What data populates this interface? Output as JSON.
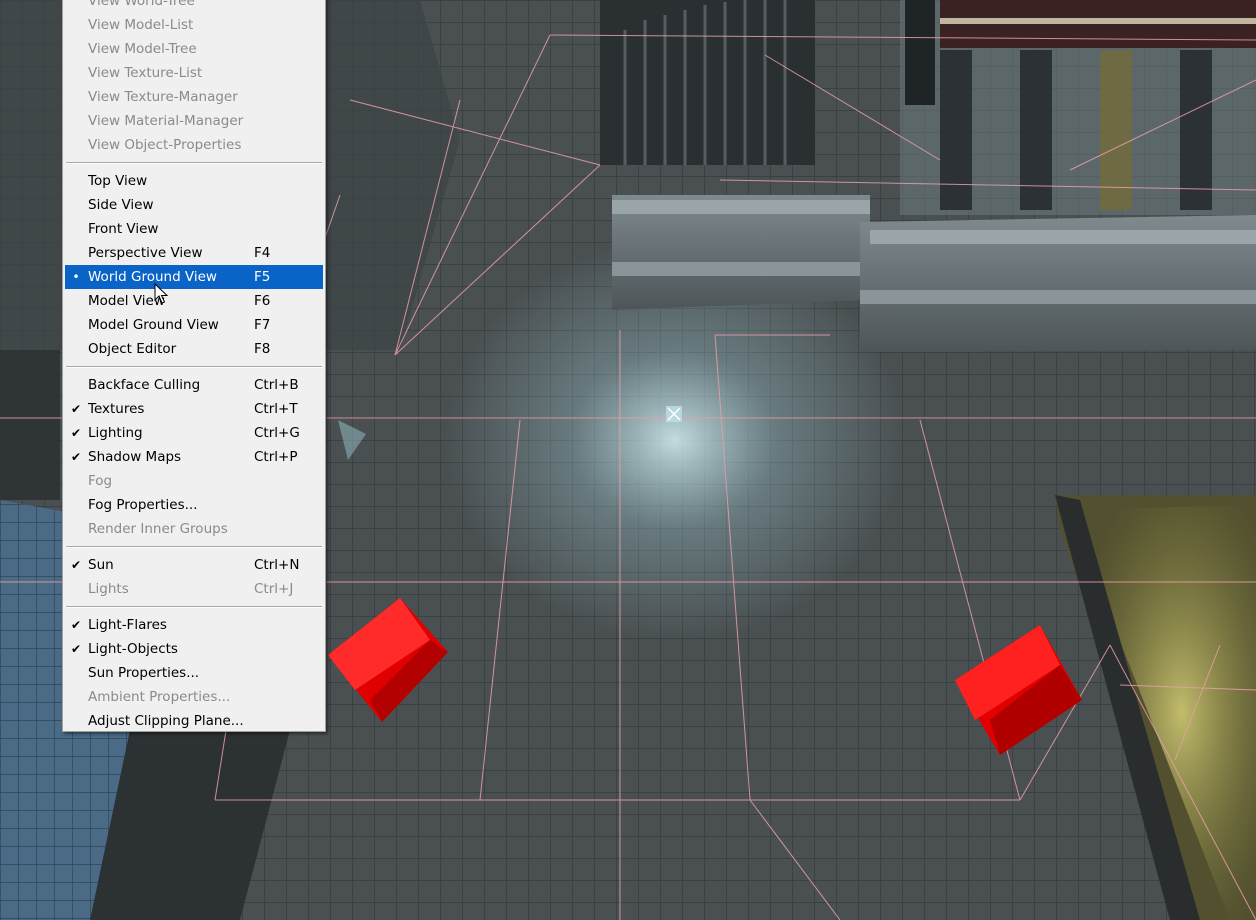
{
  "menu": {
    "items": [
      {
        "label": "View World-Tree",
        "shortcut": "",
        "disabled": true,
        "check": ""
      },
      {
        "label": "View Model-List",
        "shortcut": "",
        "disabled": true,
        "check": ""
      },
      {
        "label": "View Model-Tree",
        "shortcut": "",
        "disabled": true,
        "check": ""
      },
      {
        "label": "View Texture-List",
        "shortcut": "",
        "disabled": true,
        "check": ""
      },
      {
        "label": "View Texture-Manager",
        "shortcut": "",
        "disabled": true,
        "check": ""
      },
      {
        "label": "View Material-Manager",
        "shortcut": "",
        "disabled": true,
        "check": ""
      },
      {
        "label": "View Object-Properties",
        "shortcut": "",
        "disabled": true,
        "check": ""
      },
      {
        "label": "Top View",
        "shortcut": "",
        "disabled": false,
        "check": ""
      },
      {
        "label": "Side View",
        "shortcut": "",
        "disabled": false,
        "check": ""
      },
      {
        "label": "Front View",
        "shortcut": "",
        "disabled": false,
        "check": ""
      },
      {
        "label": "Perspective View",
        "shortcut": "F4",
        "disabled": false,
        "check": ""
      },
      {
        "label": "World Ground View",
        "shortcut": "F5",
        "disabled": false,
        "check": "•",
        "active": true
      },
      {
        "label": "Model View",
        "shortcut": "F6",
        "disabled": false,
        "check": ""
      },
      {
        "label": "Model Ground View",
        "shortcut": "F7",
        "disabled": false,
        "check": ""
      },
      {
        "label": "Object Editor",
        "shortcut": "F8",
        "disabled": false,
        "check": ""
      },
      {
        "label": "Backface Culling",
        "shortcut": "Ctrl+B",
        "disabled": false,
        "check": ""
      },
      {
        "label": "Textures",
        "shortcut": "Ctrl+T",
        "disabled": false,
        "check": "✔"
      },
      {
        "label": "Lighting",
        "shortcut": "Ctrl+G",
        "disabled": false,
        "check": "✔"
      },
      {
        "label": "Shadow Maps",
        "shortcut": "Ctrl+P",
        "disabled": false,
        "check": "✔"
      },
      {
        "label": "Fog",
        "shortcut": "",
        "disabled": true,
        "check": ""
      },
      {
        "label": "Fog Properties...",
        "shortcut": "",
        "disabled": false,
        "check": ""
      },
      {
        "label": "Render Inner Groups",
        "shortcut": "",
        "disabled": true,
        "check": ""
      },
      {
        "label": "Sun",
        "shortcut": "Ctrl+N",
        "disabled": false,
        "check": "✔"
      },
      {
        "label": "Lights",
        "shortcut": "Ctrl+J",
        "disabled": true,
        "check": ""
      },
      {
        "label": "Light-Flares",
        "shortcut": "",
        "disabled": false,
        "check": "✔"
      },
      {
        "label": "Light-Objects",
        "shortcut": "",
        "disabled": false,
        "check": "✔"
      },
      {
        "label": "Sun Properties...",
        "shortcut": "",
        "disabled": false,
        "check": ""
      },
      {
        "label": "Ambient Properties...",
        "shortcut": "",
        "disabled": true,
        "check": ""
      },
      {
        "label": "Adjust Clipping Plane...",
        "shortcut": "",
        "disabled": false,
        "check": ""
      }
    ]
  },
  "colors": {
    "menu_bg": "#f0f0f0",
    "highlight": "#0a64c8",
    "disabled_text": "#8a8a8a",
    "wire": "#e8a0a8",
    "cube": "#e00000"
  }
}
